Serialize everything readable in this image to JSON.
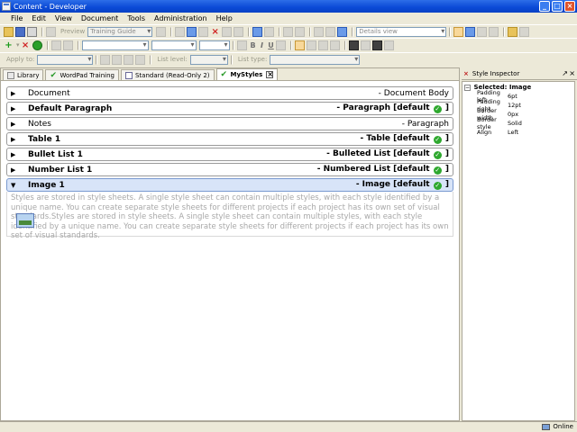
{
  "window": {
    "title": "Content - Developer"
  },
  "menu": [
    "File",
    "Edit",
    "View",
    "Document",
    "Tools",
    "Administration",
    "Help"
  ],
  "toolbar": {
    "preview_label": "Preview",
    "guide_combo": "Training Guide",
    "view_combo": "Details view",
    "apply_to_label": "Apply to:",
    "list_level_label": "List level:",
    "list_type_label": "List type:",
    "bold": "B",
    "italic": "I",
    "underline": "U"
  },
  "tabs": [
    {
      "label": "Library"
    },
    {
      "label": "WordPad Training"
    },
    {
      "label": "Standard (Read-Only 2)"
    },
    {
      "label": "MyStyles"
    }
  ],
  "styles": [
    {
      "name": "Document",
      "desc": "- Document Body",
      "bold": false,
      "default": false,
      "selected": false
    },
    {
      "name": "Default Paragraph",
      "desc": "- Paragraph [default",
      "bold": true,
      "default": true,
      "selected": false
    },
    {
      "name": "Notes",
      "desc": "- Paragraph",
      "bold": false,
      "default": false,
      "selected": false
    },
    {
      "name": "Table 1",
      "desc": "- Table [default",
      "bold": true,
      "default": true,
      "selected": false
    },
    {
      "name": "Bullet List 1",
      "desc": "- Bulleted List [default",
      "bold": true,
      "default": true,
      "selected": false
    },
    {
      "name": "Number List 1",
      "desc": "- Numbered List [default",
      "bold": true,
      "default": true,
      "selected": false
    },
    {
      "name": "Image 1",
      "desc": "- Image [default",
      "bold": true,
      "default": true,
      "selected": true
    }
  ],
  "preview": {
    "text1": "Styles are stored in style sheets. A single style sheet can contain multiple styles, with each style identified by a unique name. You can create separate style sheets for different projects if each project has its own set of visual standards.Styles are stored in style sheets. A single style sheet can contain multiple styles, with each style identified by a unique name. You can create separate style sheets for different projects if each project has its own set of visual standards."
  },
  "inspector": {
    "header": "Style Inspector",
    "selected": "Selected: Image",
    "props": [
      {
        "k": "Padding left",
        "v": "6pt"
      },
      {
        "k": "Padding right",
        "v": "12pt"
      },
      {
        "k": "Border width",
        "v": "0px"
      },
      {
        "k": "Border style",
        "v": "Solid"
      },
      {
        "k": "Align",
        "v": "Left"
      }
    ]
  },
  "status": {
    "online": "Online"
  }
}
